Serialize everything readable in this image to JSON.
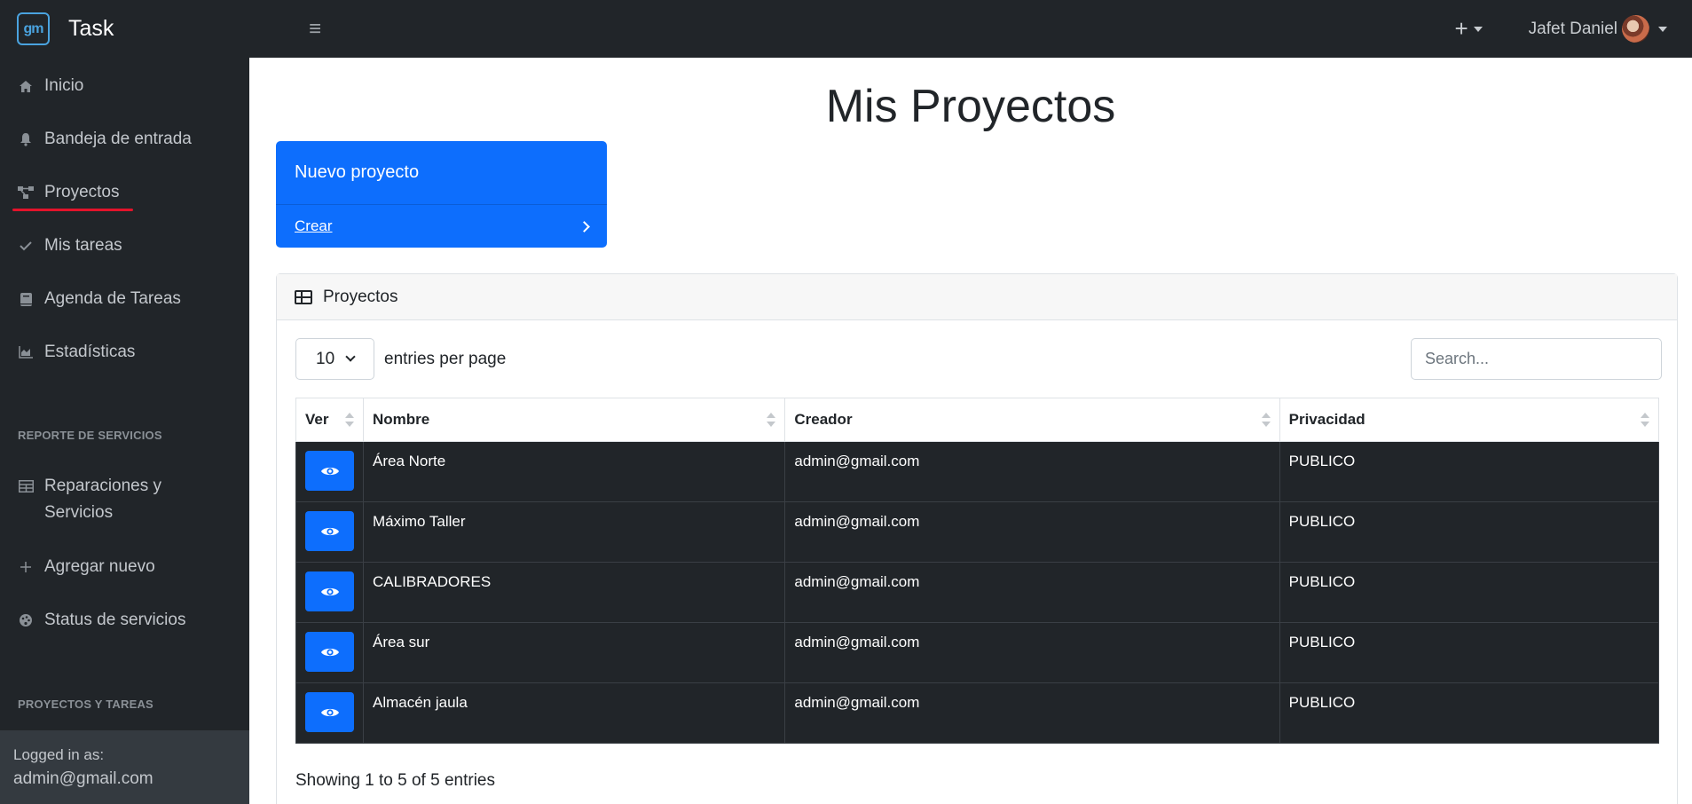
{
  "brand": {
    "logo_text": "gm",
    "name": "Task"
  },
  "topbar": {
    "plus_label": "+",
    "user_name": "Jafet Daniel"
  },
  "sidebar": {
    "items": [
      {
        "label": "Inicio",
        "icon": "home-icon"
      },
      {
        "label": "Bandeja de entrada",
        "icon": "bell-icon"
      },
      {
        "label": "Proyectos",
        "icon": "project-diagram-icon"
      },
      {
        "label": "Mis tareas",
        "icon": "check-icon"
      },
      {
        "label": "Agenda de Tareas",
        "icon": "book-icon"
      },
      {
        "label": "Estadísticas",
        "icon": "chart-area-icon"
      }
    ],
    "heading_services": "REPORTE DE SERVICIOS",
    "service_items": [
      {
        "label_line1": "Reparaciones y",
        "label_line2": "Servicios",
        "icon": "table-icon"
      },
      {
        "label": "Agregar nuevo",
        "icon": "plus-icon"
      },
      {
        "label": "Status de servicios",
        "icon": "palette-icon"
      }
    ],
    "heading_projects": "PROYECTOS Y TAREAS",
    "footer": {
      "label": "Logged in as:",
      "user": "admin@gmail.com"
    }
  },
  "main": {
    "title": "Mis Proyectos",
    "new_project_card": {
      "title": "Nuevo proyecto",
      "link": "Crear"
    },
    "projects_card": {
      "header": "Proyectos",
      "entries_value": "10",
      "entries_label": "entries per page",
      "search_placeholder": "Search...",
      "columns": [
        "Ver",
        "Nombre",
        "Creador",
        "Privacidad"
      ],
      "rows": [
        {
          "nombre": "Área Norte",
          "creador": "admin@gmail.com",
          "privacidad": "PUBLICO"
        },
        {
          "nombre": "Máximo Taller",
          "creador": "admin@gmail.com",
          "privacidad": "PUBLICO"
        },
        {
          "nombre": "CALIBRADORES",
          "creador": "admin@gmail.com",
          "privacidad": "PUBLICO"
        },
        {
          "nombre": "Área sur",
          "creador": "admin@gmail.com",
          "privacidad": "PUBLICO"
        },
        {
          "nombre": "Almacén jaula",
          "creador": "admin@gmail.com",
          "privacidad": "PUBLICO"
        }
      ],
      "showing": "Showing 1 to 5 of 5 entries"
    }
  },
  "colors": {
    "primary": "#0d6efd",
    "dark": "#212529",
    "active_underline": "#e3132b"
  }
}
